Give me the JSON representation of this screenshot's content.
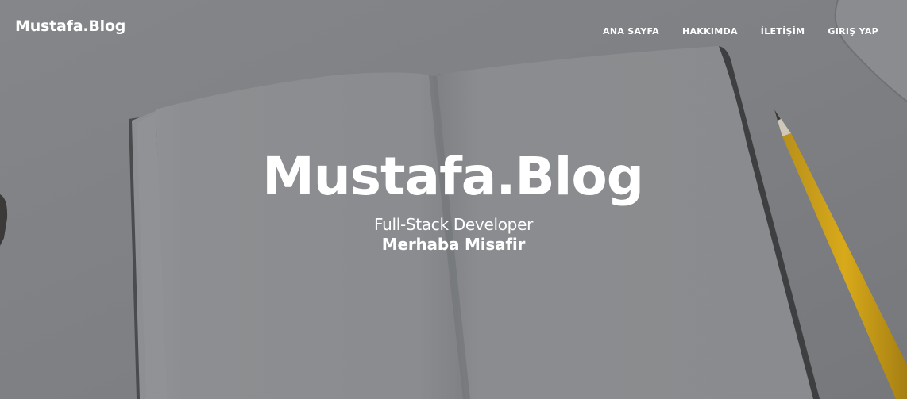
{
  "navbar": {
    "brand": "Mustafa.Blog",
    "links": [
      {
        "label": "ANA SAYFA"
      },
      {
        "label": "HAKKIMDA"
      },
      {
        "label": "İLETİŞİM"
      },
      {
        "label": "GIRIŞ YAP"
      }
    ]
  },
  "header": {
    "title": "Mustafa.Blog",
    "subtitle": "Full-Stack Developer",
    "greeting": "Merhaba Misafir"
  },
  "colors": {
    "overlay": "#7d7f82",
    "text": "#ffffff",
    "pencil": "#d8a91a"
  }
}
